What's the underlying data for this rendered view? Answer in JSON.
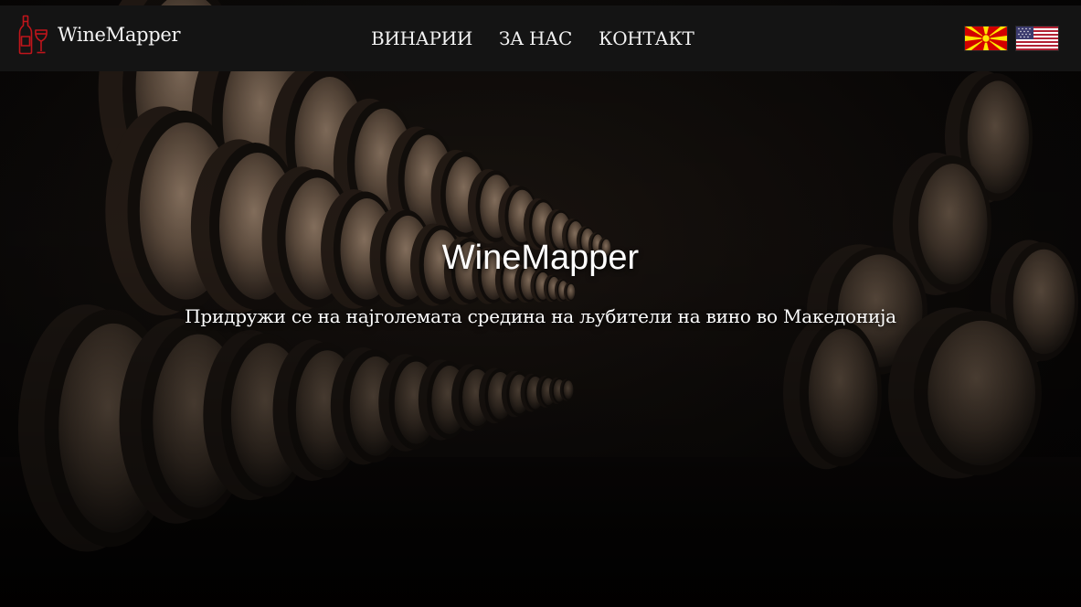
{
  "navbar": {
    "brand_name": "WineMapper",
    "brand_icon": "wine-bottle-glass-icon",
    "links": [
      {
        "label": "ВИНАРИИ"
      },
      {
        "label": "ЗА НАС"
      },
      {
        "label": "КОНТАКТ"
      }
    ],
    "languages": [
      {
        "icon": "macedonian-flag-icon"
      },
      {
        "icon": "us-flag-icon"
      }
    ]
  },
  "hero": {
    "title": "WineMapper",
    "subtitle": "Придружи се на најголемата средина на љубители на вино во Македонија",
    "background": "wine-barrel-cellar-image"
  },
  "colors": {
    "navbar_bg": "#141414",
    "brand_icon": "#c0151b",
    "text": "#f2f2f2"
  }
}
